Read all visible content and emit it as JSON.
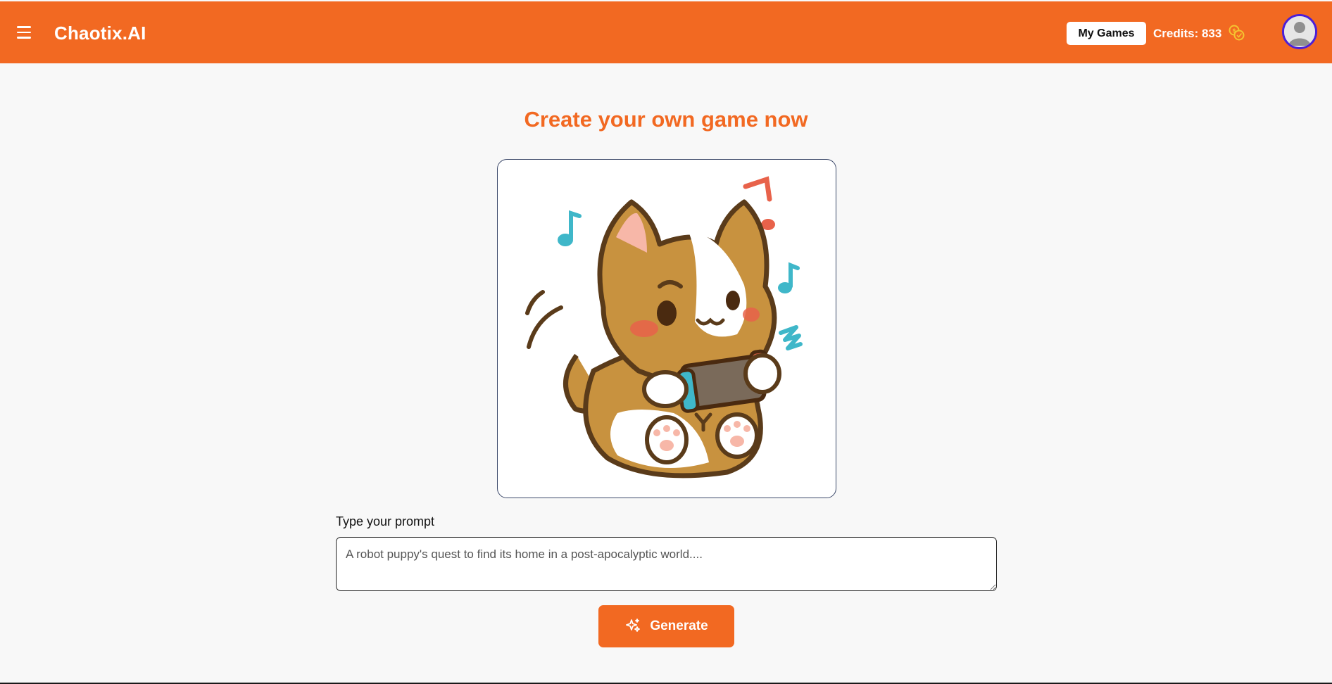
{
  "header": {
    "brand": "Chaotix.AI",
    "my_games_label": "My Games",
    "credits_text": "Credits: 833",
    "coin_icon": "coins-icon",
    "avatar_icon": "user-avatar-icon",
    "menu_icon": "hamburger-menu-icon"
  },
  "main": {
    "title": "Create your own game now",
    "illustration": "corgi-playing-handheld-game-illustration",
    "prompt_label": "Type your prompt",
    "prompt_placeholder": "A robot puppy's quest to find its home in a post-apocalyptic world....",
    "prompt_value": "",
    "generate_label": "Generate",
    "generate_icon": "sparkles-icon"
  },
  "colors": {
    "brand": "#f26922",
    "avatar_ring": "#4b1fd8",
    "coin": "#f4c430",
    "background": "#f8f8f8"
  }
}
